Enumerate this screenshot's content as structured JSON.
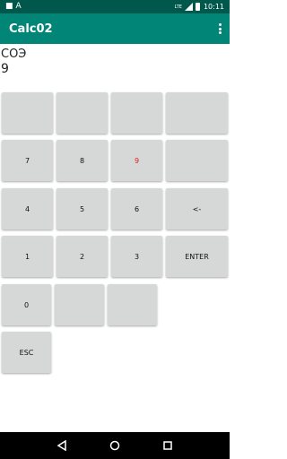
{
  "status_bar": {
    "time": "10:11",
    "lte": "LTE"
  },
  "app_bar": {
    "title": "Calc02",
    "overflow_icon": "more-vert-icon"
  },
  "display": {
    "line1": "СОЭ",
    "line2": "9"
  },
  "keypad": {
    "k7": "7",
    "k8": "8",
    "k9": "9",
    "k4": "4",
    "k5": "5",
    "k6": "6",
    "backspace": "<-",
    "k1": "1",
    "k2": "2",
    "k3": "3",
    "enter": "ENTER",
    "k0": "0",
    "esc": "ESC"
  },
  "colors": {
    "status_bar": "#00574b",
    "app_bar": "#008577",
    "key": "#d6d7d7",
    "highlight": "#e02020"
  }
}
